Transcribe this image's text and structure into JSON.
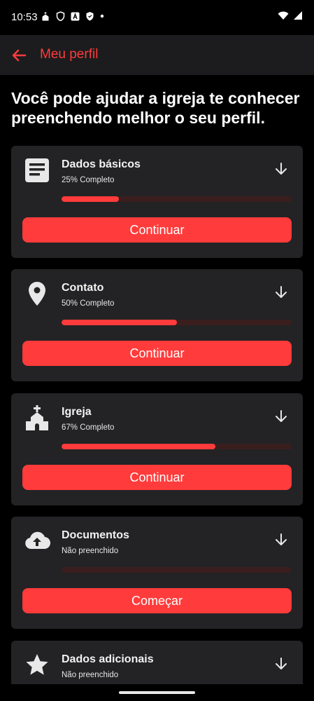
{
  "status_bar": {
    "time": "10:53"
  },
  "app_bar": {
    "title": "Meu perfil"
  },
  "headline": "Você pode ajudar a igreja te conhecer preenchendo melhor o seu perfil.",
  "colors": {
    "accent": "#ff3b3b",
    "card": "#232325",
    "appbar": "#1c1c1e",
    "track": "#3a1e1e"
  },
  "cards": [
    {
      "title": "Dados básicos",
      "status": "25% Completo",
      "progress": 0.25,
      "button": "Continuar",
      "icon": "document-icon"
    },
    {
      "title": "Contato",
      "status": "50% Completo",
      "progress": 0.5,
      "button": "Continuar",
      "icon": "location-pin-icon"
    },
    {
      "title": "Igreja",
      "status": "67% Completo",
      "progress": 0.67,
      "button": "Continuar",
      "icon": "church-icon"
    },
    {
      "title": "Documentos",
      "status": "Não preenchido",
      "progress": 0,
      "button": "Começar",
      "icon": "cloud-upload-icon"
    },
    {
      "title": "Dados adicionais",
      "status": "Não preenchido",
      "progress": 0,
      "button": "",
      "icon": "star-icon"
    }
  ]
}
